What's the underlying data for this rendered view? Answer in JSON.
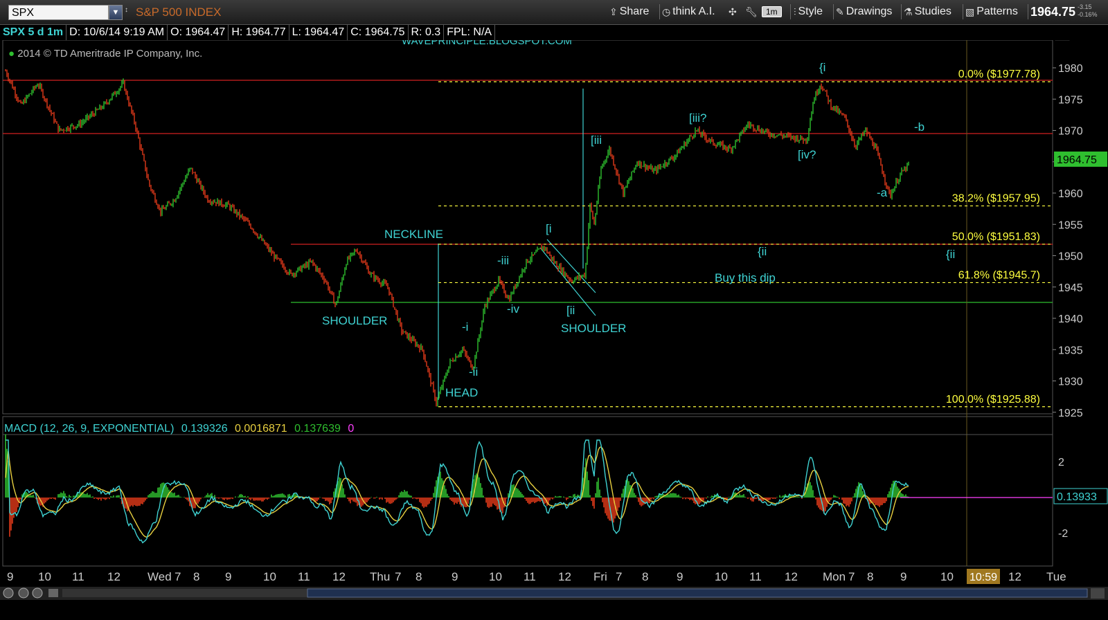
{
  "toolbar": {
    "symbol": "SPX",
    "symbol_name": "S&P 500 INDEX",
    "share_label": "Share",
    "think_ai_label": "think A.I.",
    "interval_badge": "1m",
    "style_label": "Style",
    "drawings_label": "Drawings",
    "studies_label": "Studies",
    "patterns_label": "Patterns",
    "last_price": "1964.75",
    "net_change": "-3.15",
    "pct_change": "-0.16%"
  },
  "info_bar": {
    "symbol_period": "SPX 5 d 1m",
    "date": "D: 10/6/14 9:19 AM",
    "open": "O: 1964.47",
    "high": "H: 1964.77",
    "low": "L: 1964.47",
    "close": "C: 1964.75",
    "range": "R: 0.3",
    "fpl": "FPL: N/A"
  },
  "chart": {
    "copyright": "2014 © TD Ameritrade IP Company, Inc.",
    "watermark": "WAVEPRINCIPLE.BLOGSPOT.COM",
    "price_ticks": [
      "1980",
      "1975",
      "1970",
      "1965",
      "1960",
      "1955",
      "1950",
      "1945",
      "1940",
      "1935",
      "1930",
      "1925"
    ],
    "current_price_label": "1964.75",
    "fib_labels": [
      {
        "text": "0.0%  ($1977.78)",
        "value": 1977.78
      },
      {
        "text": "38.2%  ($1957.95)",
        "value": 1957.95
      },
      {
        "text": "50.0%  ($1951.83)",
        "value": 1951.83
      },
      {
        "text": "61.8%  ($1945.7)",
        "value": 1945.7
      },
      {
        "text": "100.0%  ($1925.88)",
        "value": 1925.88
      }
    ],
    "annotations": {
      "neckline": "NECKLINE",
      "shoulder_left": "SHOULDER",
      "shoulder_right": "SHOULDER",
      "head": "HEAD",
      "buy_dip": "Buy this dip",
      "w_i": "-i",
      "w_ii": "-ii",
      "w_iii": "-iii",
      "w_iv": "-iv",
      "sq_i": "[i",
      "sq_ii": "[ii",
      "sq_iii": "[iii",
      "sq_iii_q": "[iii?",
      "sq_iv_q": "[iv?",
      "cb_i": "{i",
      "cb_ii": "{ii",
      "cb_ii_right": "{ii",
      "w_a": "-a",
      "w_b": "-b"
    },
    "time_axis": [
      "9",
      "10",
      "11",
      "12",
      "Wed",
      "7",
      "8",
      "9",
      "10",
      "11",
      "12",
      "Thu",
      "7",
      "8",
      "9",
      "10",
      "11",
      "12",
      "Fri",
      "7",
      "8",
      "9",
      "10",
      "11",
      "12",
      "Mon",
      "7",
      "8",
      "9",
      "10",
      "12",
      "Tue"
    ],
    "time_cursor": "10:59"
  },
  "macd": {
    "title": "MACD (12, 26, 9, EXPONENTIAL)",
    "value": "0.139326",
    "avg": "0.0016871",
    "diff": "0.137639",
    "extra": "0",
    "axis_ticks": [
      "2",
      "-2"
    ],
    "current_label": "0.13933"
  },
  "colors": {
    "cyan": "#3fd3d3",
    "yellow": "#ffff3f",
    "red_line": "#d12020",
    "green_line": "#2fbf2f",
    "up_candle": "#2fbf2f",
    "down_candle": "#e23a1a",
    "macd_line": "#3fd3d3",
    "signal_line": "#e8d040",
    "magenta": "#ff40ff"
  }
}
